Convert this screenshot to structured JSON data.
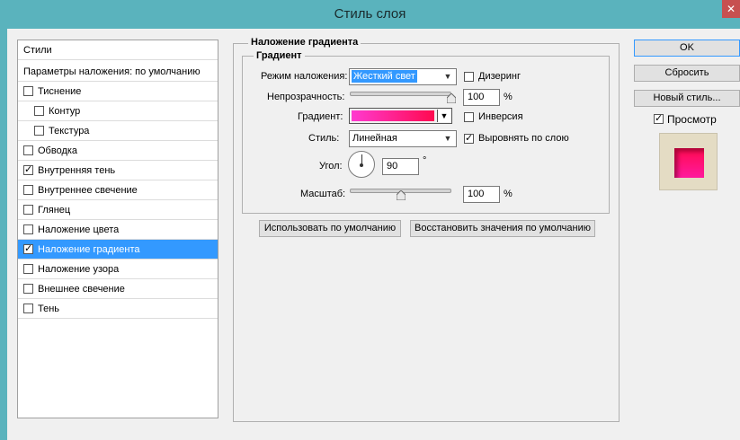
{
  "window": {
    "title": "Стиль слоя",
    "close_glyph": "✕"
  },
  "styles_panel": {
    "header": "Стили",
    "blend_default": "Параметры наложения: по умолчанию",
    "items": [
      {
        "label": "Тиснение",
        "checked": false,
        "indent": false
      },
      {
        "label": "Контур",
        "checked": false,
        "indent": true
      },
      {
        "label": "Текстура",
        "checked": false,
        "indent": true
      },
      {
        "label": "Обводка",
        "checked": false,
        "indent": false
      },
      {
        "label": "Внутренняя тень",
        "checked": true,
        "indent": false
      },
      {
        "label": "Внутреннее свечение",
        "checked": false,
        "indent": false
      },
      {
        "label": "Глянец",
        "checked": false,
        "indent": false
      },
      {
        "label": "Наложение цвета",
        "checked": false,
        "indent": false
      },
      {
        "label": "Наложение градиента",
        "checked": true,
        "indent": false,
        "selected": true
      },
      {
        "label": "Наложение узора",
        "checked": false,
        "indent": false
      },
      {
        "label": "Внешнее свечение",
        "checked": false,
        "indent": false
      },
      {
        "label": "Тень",
        "checked": false,
        "indent": false
      }
    ]
  },
  "gradient_overlay": {
    "section_title": "Наложение градиента",
    "subsection_title": "Градиент",
    "blend_mode": {
      "label": "Режим наложения:",
      "value": "Жесткий свет"
    },
    "dither": {
      "label": "Дизеринг",
      "checked": false
    },
    "opacity": {
      "label": "Непрозрачность:",
      "value": "100",
      "unit": "%",
      "level": 100
    },
    "gradient": {
      "label": "Градиент:",
      "start_color": "#ff3ad0",
      "end_color": "#ff0a50"
    },
    "reverse": {
      "label": "Инверсия",
      "checked": false
    },
    "style": {
      "label": "Стиль:",
      "value": "Линейная"
    },
    "align": {
      "label": "Выровнять по слою",
      "checked": true
    },
    "angle": {
      "label": "Угол:",
      "value": "90",
      "unit": "°"
    },
    "scale": {
      "label": "Масштаб:",
      "value": "100",
      "unit": "%",
      "level": 50
    },
    "make_default_button": "Использовать по умолчанию",
    "reset_default_button": "Восстановить значения по умолчанию"
  },
  "actions": {
    "ok": "OK",
    "reset": "Сбросить",
    "new_style": "Новый стиль...",
    "preview": {
      "label": "Просмотр",
      "checked": true
    }
  },
  "colors": {
    "titlebar": "#5ab3bd",
    "selection": "#3399ff",
    "preview_bg": "#e4dcc4"
  }
}
